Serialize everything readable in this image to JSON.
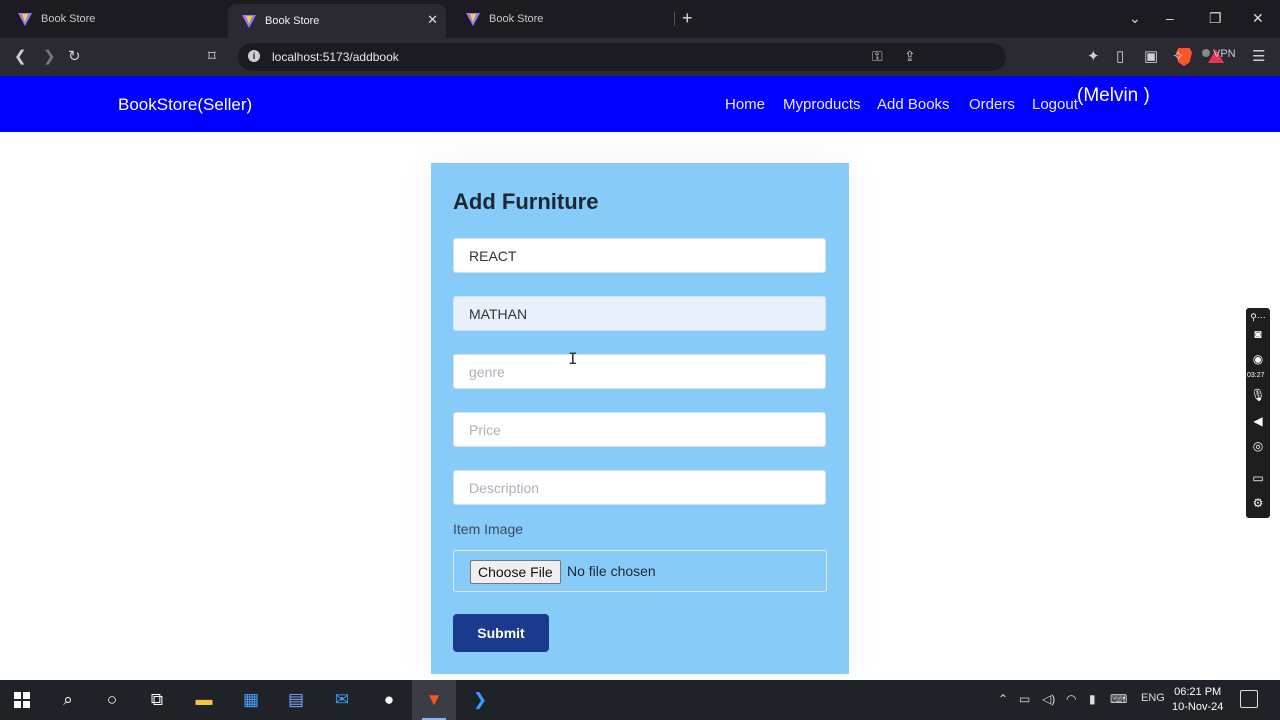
{
  "browser": {
    "tabs": [
      {
        "title": "Book Store",
        "active": false
      },
      {
        "title": "Book Store",
        "active": true
      },
      {
        "title": "Book Store",
        "active": false
      }
    ],
    "url": "localhost:5173/addbook",
    "vpn_label": "VPN"
  },
  "navbar": {
    "brand": "BookStore(Seller)",
    "links": [
      "Home",
      "Myproducts",
      "Add Books",
      "Orders",
      "Logout"
    ],
    "user": "(Melvin )",
    "background_color": "#0000ff"
  },
  "form": {
    "title": "Add Furniture",
    "fields": [
      {
        "name": "title",
        "value": "REACT",
        "placeholder": ""
      },
      {
        "name": "author",
        "value": "MATHAN",
        "placeholder": ""
      },
      {
        "name": "genre",
        "value": "",
        "placeholder": "genre"
      },
      {
        "name": "price",
        "value": "",
        "placeholder": "Price"
      },
      {
        "name": "description",
        "value": "",
        "placeholder": "Description"
      }
    ],
    "image_label": "Item Image",
    "choose_file_label": "Choose File",
    "no_file_text": "No file chosen",
    "submit_label": "Submit",
    "card_color": "#87cbf9",
    "submit_color": "#1b3a8e"
  },
  "recorder": {
    "time": "03:27",
    "icons": [
      "link-icon",
      "camera-icon",
      "record-icon",
      "mic-icon",
      "speaker-icon",
      "webcam-icon",
      "window-icon",
      "gear-icon"
    ]
  },
  "taskbar": {
    "language": "ENG",
    "time": "06:21 PM",
    "date": "10-Nov-24"
  }
}
